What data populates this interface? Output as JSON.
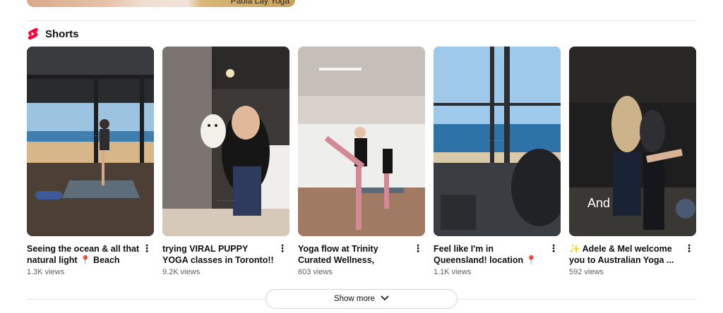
{
  "top_card": {
    "caption": "Paula Lay Yoga"
  },
  "shelf": {
    "title": "Shorts",
    "icon": "shorts-logo-icon",
    "accent": "#ff0033"
  },
  "shorts": [
    {
      "title": "Seeing the ocean & all that natural light 📍 Beach Yog...",
      "views": "1.3K views"
    },
    {
      "title": "trying VIRAL PUPPY YOGA classes in Toronto!!🐶 ...",
      "views": "9.2K views"
    },
    {
      "title": "Yoga flow at Trinity Curated Wellness, Melbourne ...",
      "views": "603 views"
    },
    {
      "title": "Feel like I'm in Queensland! location 📍 Beach Yoga, ...",
      "views": "1.1K views"
    },
    {
      "title": "✨ Adele & Mel welcome you to Australian Yoga ...",
      "views": "592 views"
    }
  ],
  "overlay_word": "And",
  "show_more": {
    "label": "Show more",
    "icon": "chevron-down-icon"
  }
}
